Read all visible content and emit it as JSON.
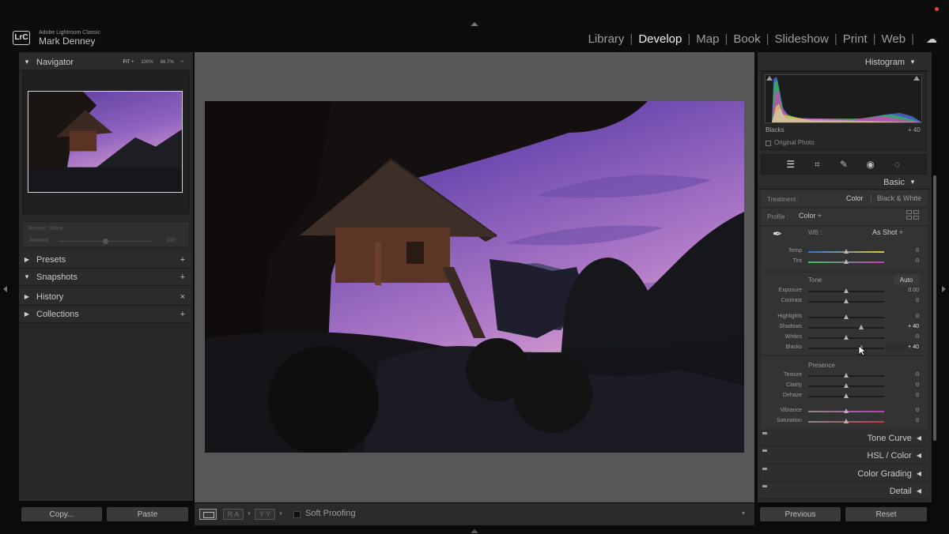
{
  "app": {
    "logo": "LrC",
    "name": "Adobe Lightroom Classic",
    "user": "Mark Denney"
  },
  "modules": [
    {
      "label": "Library",
      "active": false
    },
    {
      "label": "Develop",
      "active": true
    },
    {
      "label": "Map",
      "active": false
    },
    {
      "label": "Book",
      "active": false
    },
    {
      "label": "Slideshow",
      "active": false
    },
    {
      "label": "Print",
      "active": false
    },
    {
      "label": "Web",
      "active": false
    }
  ],
  "navigator": {
    "title": "Navigator",
    "options": [
      "FIT ÷",
      "100%",
      "66.7%",
      "÷"
    ]
  },
  "preset_amount": {
    "preset": "Preset : None",
    "amount_label": "Amount",
    "amount_value": "100",
    "level": 0.5
  },
  "left_sections": [
    {
      "label": "Presets",
      "expanded": false,
      "action": "+"
    },
    {
      "label": "Snapshots",
      "expanded": true,
      "action": "+"
    },
    {
      "label": "History",
      "expanded": false,
      "action": "×"
    },
    {
      "label": "Collections",
      "expanded": false,
      "action": "+"
    }
  ],
  "left_buttons": {
    "copy": "Copy...",
    "paste": "Paste"
  },
  "toolbar": {
    "ra": "R A",
    "yy": "Y Y",
    "soft_proofing": "Soft Proofing"
  },
  "histogram": {
    "title": "Histogram",
    "label": "Blacks",
    "value": "+ 40",
    "original_photo": "Original Photo"
  },
  "basic": {
    "title": "Basic",
    "treatment_label": "Treatment :",
    "treatment_color": "Color",
    "treatment_bw": "Black & White",
    "profile_label": "Profile :",
    "profile_value": "Color ÷",
    "wb_label": "WB :",
    "wb_value": "As Shot ÷",
    "tone_label": "Tone",
    "auto": "Auto",
    "presence_label": "Presence"
  },
  "sliders": {
    "temp": {
      "label": "Temp",
      "value": "0",
      "level": 0.5
    },
    "tint": {
      "label": "Tint",
      "value": "0",
      "level": 0.5
    },
    "exposure": {
      "label": "Exposure",
      "value": "0.00",
      "level": 0.5
    },
    "contrast": {
      "label": "Contrast",
      "value": "0",
      "level": 0.5
    },
    "highlights": {
      "label": "Highlights",
      "value": "0",
      "level": 0.5
    },
    "shadows": {
      "label": "Shadows",
      "value": "+ 40",
      "level": 0.7
    },
    "whites": {
      "label": "Whites",
      "value": "0",
      "level": 0.5
    },
    "blacks": {
      "label": "Blacks",
      "value": "+ 40",
      "level": 0.7
    },
    "texture": {
      "label": "Texture",
      "value": "0",
      "level": 0.5
    },
    "clarity": {
      "label": "Clarity",
      "value": "0",
      "level": 0.5
    },
    "dehaze": {
      "label": "Dehaze",
      "value": "0",
      "level": 0.5
    },
    "vibrance": {
      "label": "Vibrance",
      "value": "0",
      "level": 0.5
    },
    "saturation": {
      "label": "Saturation",
      "value": "0",
      "level": 0.5
    }
  },
  "right_sections": [
    {
      "label": "Tone Curve"
    },
    {
      "label": "HSL / Color"
    },
    {
      "label": "Color Grading"
    },
    {
      "label": "Detail"
    }
  ],
  "right_buttons": {
    "previous": "Previous",
    "reset": "Reset"
  }
}
